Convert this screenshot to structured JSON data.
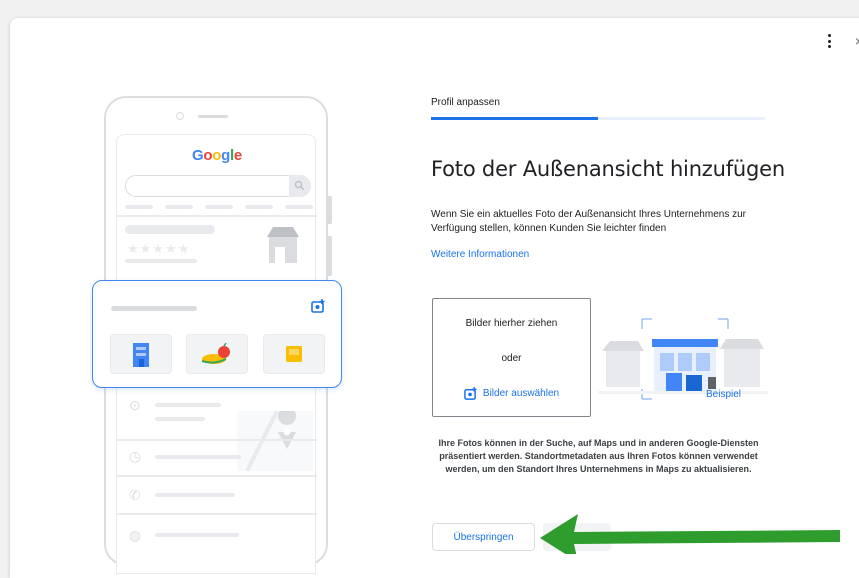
{
  "window": {
    "menu_icon": "more-vert-icon",
    "close_label": "×"
  },
  "illustration": {
    "logo_letters": [
      {
        "ch": "G",
        "color": "#4285f4"
      },
      {
        "ch": "o",
        "color": "#ea4335"
      },
      {
        "ch": "o",
        "color": "#fbbc04"
      },
      {
        "ch": "g",
        "color": "#4285f4"
      },
      {
        "ch": "l",
        "color": "#34a853"
      },
      {
        "ch": "e",
        "color": "#ea4335"
      }
    ],
    "stars": "★★★★★"
  },
  "wizard": {
    "step_label": "Profil anpassen",
    "progress_fraction": 0.5,
    "title": "Foto der Außenansicht hinzufügen",
    "description": "Wenn Sie ein aktuelles Foto der Außenansicht Ihres Unternehmens zur Verfügung stellen, können Kunden Sie leichter finden",
    "learn_more": "Weitere Informationen",
    "dropzone": {
      "drag_text": "Bilder hierher ziehen",
      "or_text": "oder",
      "select_label": "Bilder auswählen"
    },
    "example_label": "Beispiel",
    "footnote": "Ihre Fotos können in der Suche, auf Maps und in anderen Google-Diensten präsentiert werden. Standortmetadaten aus Ihren Fotos können verwendet werden, um den Standort Ihres Unternehmens in Maps zu aktualisieren.",
    "skip_label": "Überspringen"
  },
  "colors": {
    "accent": "#1a73e8",
    "arrow": "#1e8e3e"
  }
}
